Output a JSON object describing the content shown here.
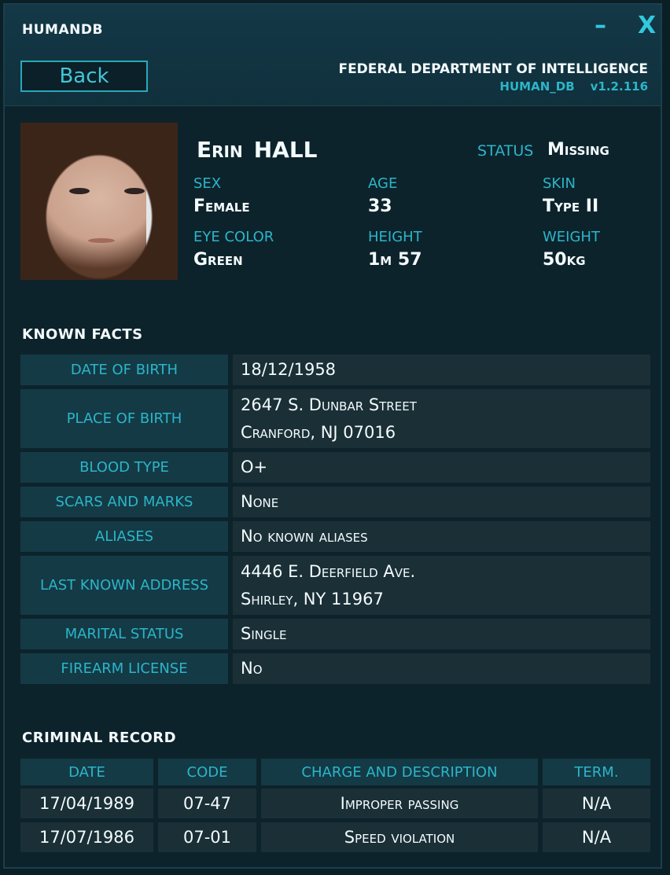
{
  "app": {
    "title": "HUMANDB",
    "minimize_icon": "minimize-icon",
    "close_icon": "close-icon",
    "minimize_glyph": "–",
    "close_glyph": "X"
  },
  "header": {
    "back_label": "Back",
    "department": "FEDERAL DEPARTMENT OF INTELLIGENCE",
    "db_name": "HUMAN_DB",
    "version": "v1.2.116"
  },
  "profile": {
    "first_name": "Erin",
    "last_name": "HALL",
    "status_label": "STATUS",
    "status_value": "Missing",
    "attributes": [
      {
        "label": "SEX",
        "value": "Female"
      },
      {
        "label": "AGE",
        "value": "33"
      },
      {
        "label": "SKIN",
        "value": "Type II"
      },
      {
        "label": "EYE COLOR",
        "value": "Green"
      },
      {
        "label": "HEIGHT",
        "value": "1m 57"
      },
      {
        "label": "WEIGHT",
        "value": "50kg"
      }
    ]
  },
  "known_facts": {
    "title": "KNOWN  FACTS",
    "rows": [
      {
        "label": "DATE OF BIRTH",
        "line1": "18/12/1958",
        "line2": ""
      },
      {
        "label": "PLACE OF BIRTH",
        "line1": "2647 S. Dunbar Street",
        "line2": "Cranford, NJ 07016"
      },
      {
        "label": "BLOOD TYPE",
        "line1": "O+",
        "line2": ""
      },
      {
        "label": "SCARS AND MARKS",
        "line1": "None",
        "line2": ""
      },
      {
        "label": "ALIASES",
        "line1": "No known aliases",
        "line2": ""
      },
      {
        "label": "LAST KNOWN ADDRESS",
        "line1": "4446 E. Deerfield Ave.",
        "line2": "Shirley, NY 11967"
      },
      {
        "label": "MARITAL STATUS",
        "line1": "Single",
        "line2": ""
      },
      {
        "label": "FIREARM LICENSE",
        "line1": "No",
        "line2": ""
      }
    ]
  },
  "criminal_record": {
    "title": "CRIMINAL  RECORD",
    "headers": [
      "DATE",
      "CODE",
      "CHARGE AND DESCRIPTION",
      "TERM."
    ],
    "rows": [
      [
        "17/04/1989",
        "07-47",
        "Improper passing",
        "N/A"
      ],
      [
        "17/07/1986",
        "07-01",
        "Speed violation",
        "N/A"
      ]
    ]
  },
  "colors": {
    "accent": "#2cb5c9",
    "background": "#0d232c",
    "label_cell": "#143a45",
    "value_cell": "#1a2f36"
  }
}
